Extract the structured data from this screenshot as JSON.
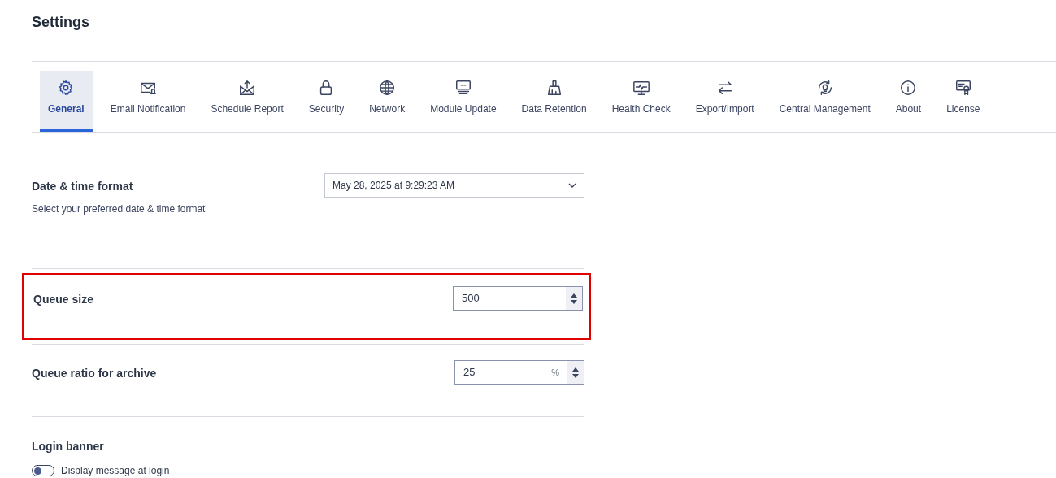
{
  "title": "Settings",
  "tabs": [
    {
      "label": "General",
      "selected": true
    },
    {
      "label": "Email Notification",
      "selected": false
    },
    {
      "label": "Schedule Report",
      "selected": false
    },
    {
      "label": "Security",
      "selected": false
    },
    {
      "label": "Network",
      "selected": false
    },
    {
      "label": "Module Update",
      "selected": false
    },
    {
      "label": "Data Retention",
      "selected": false
    },
    {
      "label": "Health Check",
      "selected": false
    },
    {
      "label": "Export/Import",
      "selected": false
    },
    {
      "label": "Central Management",
      "selected": false
    },
    {
      "label": "About",
      "selected": false
    },
    {
      "label": "License",
      "selected": false
    }
  ],
  "sections": [
    {
      "kind": "select",
      "label": "Date & time format",
      "description": "Select your preferred date & time format",
      "value": "May 28, 2025 at 9:29:23 AM",
      "highlighted": false
    },
    {
      "kind": "number",
      "label": "Queue size",
      "value": "500",
      "highlighted": true
    },
    {
      "kind": "number",
      "label": "Queue ratio for archive",
      "value": "25",
      "unit": "%",
      "highlighted": false
    },
    {
      "kind": "toggle",
      "label": "Login banner",
      "toggle_label": "Display message at login",
      "on": false,
      "highlighted": false
    }
  ]
}
